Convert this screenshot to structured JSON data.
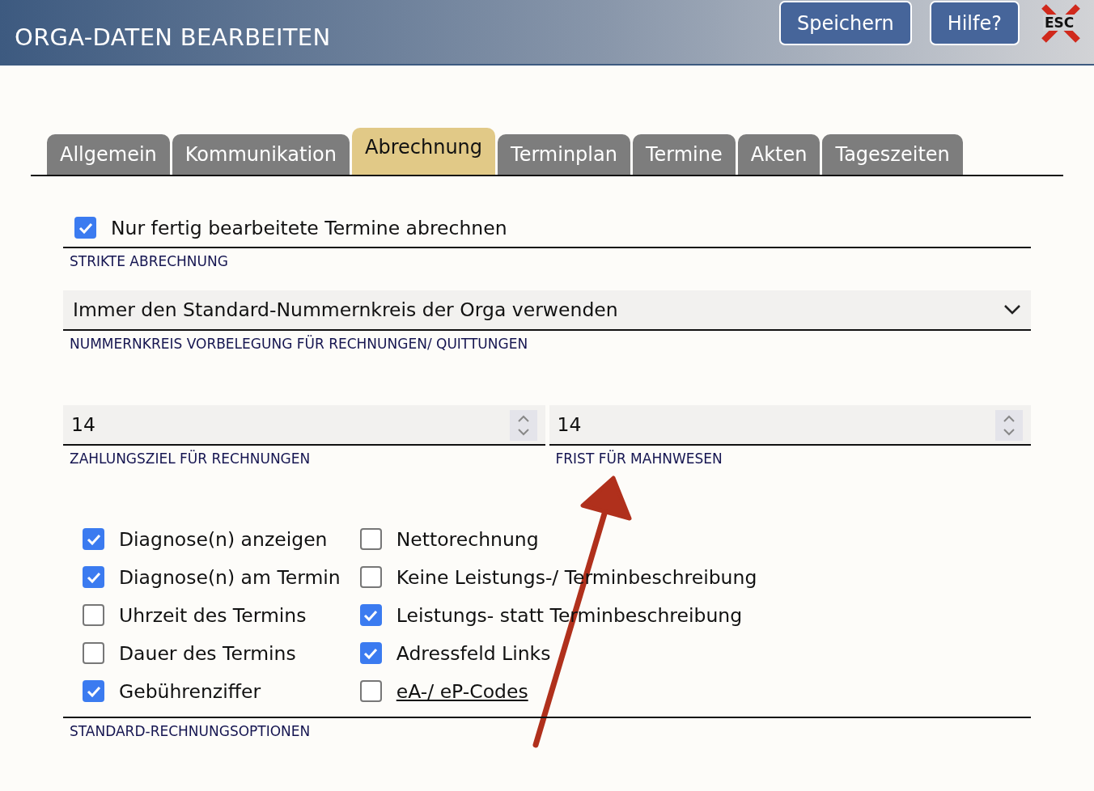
{
  "header": {
    "title": "ORGA-DATEN BEARBEITEN",
    "buttons": [
      "Speichern",
      "Hilfe?"
    ],
    "close_label": "ESC"
  },
  "tabs": [
    {
      "label": "Allgemein",
      "selected": false
    },
    {
      "label": "Kommunikation",
      "selected": false
    },
    {
      "label": "Abrechnung",
      "selected": true
    },
    {
      "label": "Terminplan",
      "selected": false
    },
    {
      "label": "Termine",
      "selected": false
    },
    {
      "label": "Akten",
      "selected": false
    },
    {
      "label": "Tageszeiten",
      "selected": false
    }
  ],
  "strict": {
    "option": {
      "label": "Nur fertig bearbeitete Termine abrechnen",
      "checked": true
    },
    "caption": "STRIKTE ABRECHNUNG"
  },
  "number_range": {
    "value": "Immer den Standard-Nummernkreis der Orga verwenden",
    "caption": "NUMMERNKREIS VORBELEGUNG FÜR RECHNUNGEN/ QUITTUNGEN"
  },
  "number_fields": [
    {
      "value": "14",
      "caption": "ZAHLUNGSZIEL FÜR RECHNUNGEN"
    },
    {
      "value": "14",
      "caption": "FRIST FÜR MAHNWESEN"
    }
  ],
  "invoice_options": {
    "columns": [
      [
        {
          "label": "Diagnose(n) anzeigen",
          "checked": true,
          "kind": "plain"
        },
        {
          "label": "Diagnose(n) am Termin",
          "checked": true,
          "kind": "plain"
        },
        {
          "label": "Uhrzeit des Termins",
          "checked": false,
          "kind": "plain"
        },
        {
          "label": "Dauer des Termins",
          "checked": false,
          "kind": "plain"
        },
        {
          "label": "Gebührenziffer",
          "checked": true,
          "kind": "plain"
        }
      ],
      [
        {
          "label": "Nettorechnung",
          "checked": false,
          "kind": "plain"
        },
        {
          "label": "Keine Leistungs-/ Terminbeschreibung",
          "checked": false,
          "kind": "plain"
        },
        {
          "label": "Leistungs- statt Terminbeschreibung",
          "checked": true,
          "kind": "plain"
        },
        {
          "label": "Adressfeld Links",
          "checked": true,
          "kind": "plain"
        },
        {
          "label": "eA-/ eP-Codes",
          "checked": false,
          "kind": "link"
        }
      ]
    ],
    "caption": "STANDARD-RECHNUNGSOPTIONEN"
  }
}
